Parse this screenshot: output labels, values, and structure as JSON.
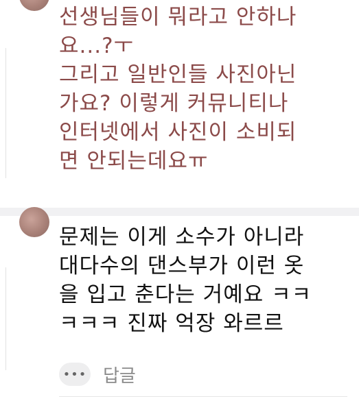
{
  "comments": [
    {
      "color": "#8b4a49",
      "lines": [
        "선생님들이 뭐라고 안하나",
        "요...?ㅜ",
        "그리고 일반인들 사진아닌",
        "가요? 이렇게 커뮤니티나",
        "인터넷에서 사진이 소비되",
        "면 안되는데요ㅠ"
      ]
    },
    {
      "color": "#111111",
      "lines": [
        "문제는 이게 소수가 아니라",
        "대다수의 댄스부가 이런 옷",
        "을 입고 춘다는 거예요 ㅋㅋ",
        "ㅋㅋㅋ 진짜 억장 와르르"
      ],
      "more_icon": "more-dots-icon",
      "more_glyph": "•••",
      "reply_label": "답글"
    }
  ]
}
